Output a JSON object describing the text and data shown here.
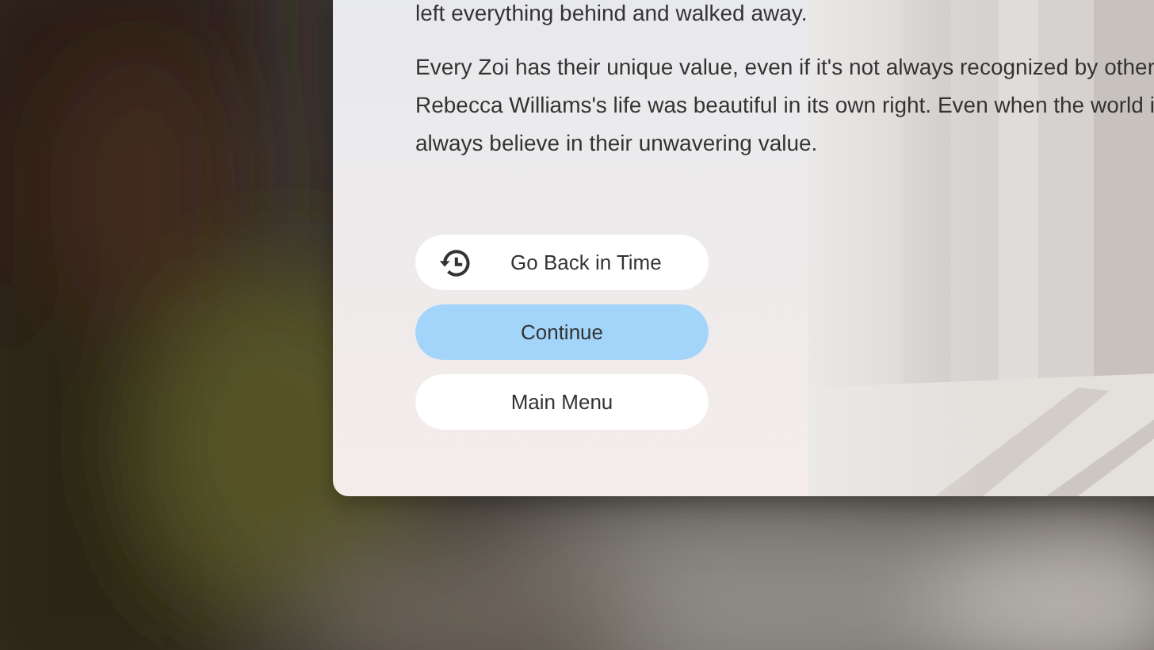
{
  "story": {
    "intro_line": "left everything behind and walked away.",
    "paragraph_lines": [
      "Every Zoi has their unique value, even if it's not always recognized by other",
      "Rebecca Williams's life was beautiful in its own right. Even when the world i",
      "always believe in their unwavering value."
    ]
  },
  "buttons": [
    {
      "label": "Go Back in Time",
      "kind": "history",
      "selected": false
    },
    {
      "label": "Continue",
      "kind": "plain",
      "selected": true
    },
    {
      "label": "Main Menu",
      "kind": "plain",
      "selected": false
    }
  ]
}
